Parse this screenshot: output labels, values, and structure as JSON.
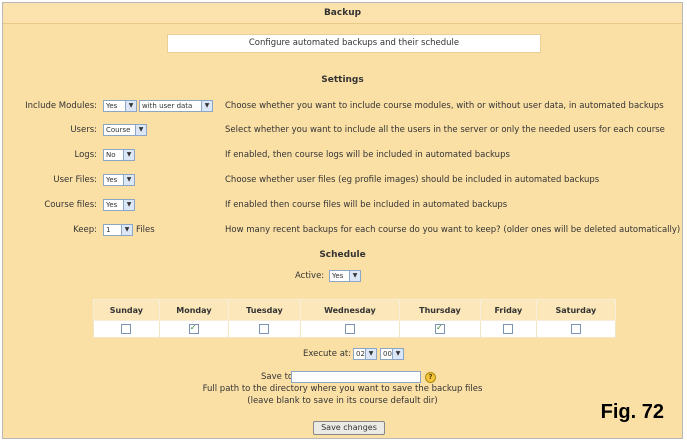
{
  "header": {
    "title": "Backup",
    "subtitle": "Configure automated backups and their schedule"
  },
  "settings": {
    "title": "Settings",
    "rows": [
      {
        "label": "Include Modules:",
        "selects": [
          "Yes",
          "with user data"
        ],
        "description": "Choose whether you want to include course modules, with or without user data, in automated backups"
      },
      {
        "label": "Users:",
        "selects": [
          "Course"
        ],
        "description": "Select whether you want to include all the users in the server or only the needed users for each course"
      },
      {
        "label": "Logs:",
        "selects": [
          "No"
        ],
        "description": "If enabled, then course logs will be included in automated backups"
      },
      {
        "label": "User Files:",
        "selects": [
          "Yes"
        ],
        "description": "Choose whether user files (eg profile images) should be included in automated backups"
      },
      {
        "label": "Course files:",
        "selects": [
          "Yes"
        ],
        "description": "If enabled then course files will be included in automated backups"
      },
      {
        "label": "Keep:",
        "selects": [
          "1"
        ],
        "suffix": "Files",
        "description": "How many recent backups for each course do you want to keep? (older ones will be deleted automatically)"
      }
    ]
  },
  "schedule": {
    "title": "Schedule",
    "active_label": "Active:",
    "active_value": "Yes",
    "days": [
      {
        "name": "Sunday",
        "checked": false
      },
      {
        "name": "Monday",
        "checked": true
      },
      {
        "name": "Tuesday",
        "checked": false
      },
      {
        "name": "Wednesday",
        "checked": false
      },
      {
        "name": "Thursday",
        "checked": true
      },
      {
        "name": "Friday",
        "checked": false
      },
      {
        "name": "Saturday",
        "checked": false
      }
    ],
    "execute_label": "Execute at:",
    "execute_hour": "02",
    "execute_minute": "00",
    "save_to_label": "Save to:",
    "save_to_value": "",
    "save_help_1": "Full path to the directory where you want to save the backup files",
    "save_help_2": "(leave blank to save in its course default dir)",
    "save_button": "Save changes"
  },
  "figure_label": "Fig. 72"
}
